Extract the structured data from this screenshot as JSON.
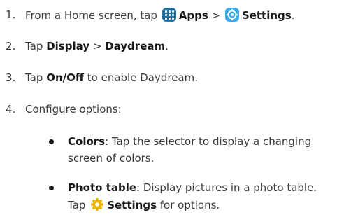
{
  "steps": [
    {
      "number": "1.",
      "pre": "From a Home screen, tap",
      "apps_label": "Apps",
      "sep": ">",
      "settings_label": "Settings",
      "post": "."
    },
    {
      "number": "2.",
      "pre": "Tap",
      "display_label": "Display",
      "sep": ">",
      "daydream_label": "Daydream",
      "post": "."
    },
    {
      "number": "3.",
      "pre": "Tap",
      "onoff_label": "On/Off",
      "post": "to enable Daydream."
    },
    {
      "number": "4.",
      "text": "Configure options:"
    }
  ],
  "options": [
    {
      "label": "Colors",
      "line1": ": Tap the selector to display a changing",
      "line2": "screen of colors."
    },
    {
      "label": "Photo table",
      "line1": ": Display pictures in a photo table.",
      "line2_pre": "Tap",
      "line2_label": "Settings",
      "line2_post": "for options."
    }
  ],
  "icons": {
    "apps_icon": "apps-grid-icon",
    "settings_icon": "settings-gear-icon",
    "photo_settings_icon": "gear-icon"
  },
  "colors": {
    "apps_icon_bg": "#1f6f9c",
    "settings_icon_bg": "#36a9e6",
    "gear_icon": "#f0b400",
    "text": "#3a3a3a",
    "bold_text": "#1a1a1a"
  }
}
